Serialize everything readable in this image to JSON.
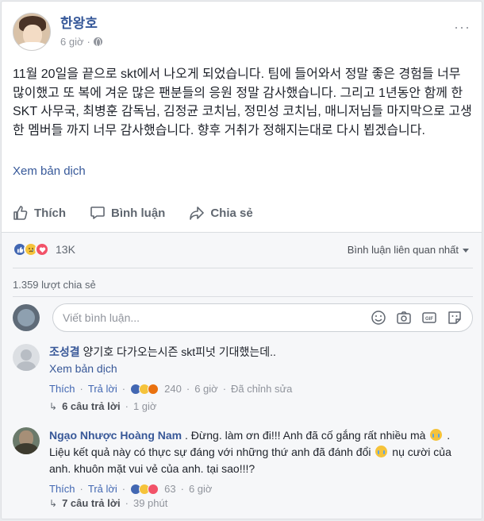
{
  "post": {
    "author": "한왕호",
    "time": "6 giờ",
    "more": "···",
    "text": "11월 20일을 끝으로 skt에서 나오게 되었습니다. 팀에 들어와서 정말 좋은 경험들 너무 많이했고 또 복에 겨운 많은 팬분들의 응원 정말 감사했습니다. 그리고 1년동안 함께 한 SKT 사무국, 최병훈 감독님, 김정균 코치님, 정민성 코치님, 매니저님들 마지막으로 고생한 멤버들 까지 너무 감사했습니다. 향후 거취가 정해지는대로 다시 뵙겠습니다.",
    "translate": "Xem bản dịch"
  },
  "actions": {
    "like": "Thích",
    "comment": "Bình luận",
    "share": "Chia sẻ"
  },
  "stats": {
    "reaction_count": "13K",
    "sort": "Bình luận liên quan nhất",
    "shares": "1.359 lượt chia sẻ"
  },
  "composer": {
    "placeholder": "Viết bình luận..."
  },
  "comments": [
    {
      "name": "조성결",
      "text": "양기호 다가오는시즌 skt피넛 기대했는데..",
      "translate": "Xem bản dịch",
      "like": "Thích",
      "reply": "Trả lời",
      "reactions": "240",
      "time": "6 giờ",
      "edited": "Đã chỉnh sửa",
      "replies": "6 câu trả lời",
      "replies_time": "1 giờ"
    },
    {
      "name": "Ngạo Nhược Hoàng Nam",
      "text_a": ". Đừng. làm ơn đi!!! Anh đã cố gắng rất nhiều mà",
      "text_b": ". Liệu kết quả này có thực sự đáng với những thứ anh đã đánh đổi",
      "text_c": "nụ cười",
      "text_d": "của anh. khuôn mặt vui vẻ của anh. tại sao!!!?",
      "like": "Thích",
      "reply": "Trả lời",
      "reactions": "63",
      "time": "6 giờ",
      "replies": "7 câu trả lời",
      "replies_time": "39 phút"
    }
  ],
  "separator": "·",
  "reaction_icons": [
    "like-icon",
    "sad-icon",
    "love-icon",
    "angry-icon"
  ],
  "colors": {
    "link": "#365899",
    "accent": "#4267b2",
    "muted": "#90949c"
  }
}
